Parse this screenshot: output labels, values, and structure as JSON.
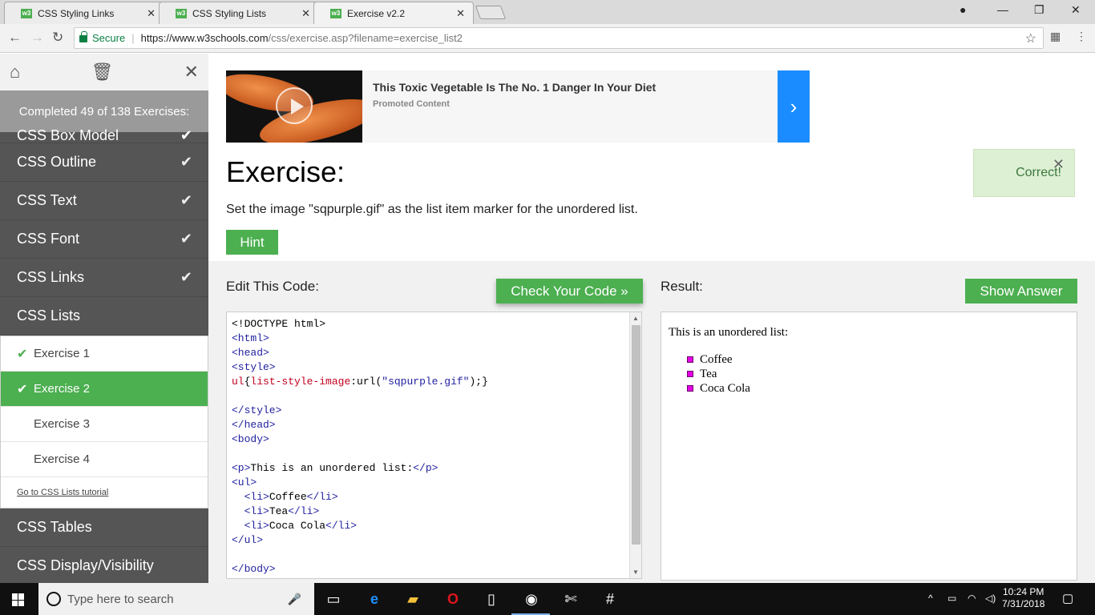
{
  "browser": {
    "tabs": [
      {
        "label": "CSS Styling Links",
        "favicon": "w3"
      },
      {
        "label": "CSS Styling Lists",
        "favicon": "w3"
      },
      {
        "label": "Exercise v2.2",
        "favicon": "w3"
      }
    ],
    "secure_label": "Secure",
    "url_host": "https://www.w3schools.com",
    "url_path": "/css/exercise.asp?filename=exercise_list2"
  },
  "sidebar": {
    "progress": "Completed 49 of 138 Exercises:",
    "cut_item": "CSS Box Model",
    "items": [
      {
        "label": "CSS Outline"
      },
      {
        "label": "CSS Text"
      },
      {
        "label": "CSS Font"
      },
      {
        "label": "CSS Links"
      },
      {
        "label": "CSS Lists"
      }
    ],
    "subitems": [
      {
        "label": "Exercise 1",
        "done": true
      },
      {
        "label": "Exercise 2",
        "done": true,
        "active": true
      },
      {
        "label": "Exercise 3",
        "done": false
      },
      {
        "label": "Exercise 4",
        "done": false
      }
    ],
    "tutorial_link": "Go to CSS Lists tutorial",
    "items_after": [
      {
        "label": "CSS Tables"
      },
      {
        "label": "CSS Display/Visibility"
      }
    ]
  },
  "ad": {
    "title": "This Toxic Vegetable Is The No. 1 Danger In Your Diet",
    "subtitle": "Promoted Content"
  },
  "exercise": {
    "title": "Exercise:",
    "description": "Set the image \"sqpurple.gif\" as the list item marker for the unordered list.",
    "hint_label": "Hint",
    "toast": "Correct!"
  },
  "editor": {
    "label": "Edit This Code:",
    "check_label": "Check Your Code »"
  },
  "result": {
    "label": "Result:",
    "answer_label": "Show Answer",
    "paragraph": "This is an unordered list:",
    "list": [
      "Coffee",
      "Tea",
      "Coca Cola"
    ]
  },
  "taskbar": {
    "search_placeholder": "Type here to search",
    "time": "10:24 PM",
    "date": "7/31/2018"
  },
  "colors": {
    "accent": "#4caf50",
    "sidebar": "#555555",
    "ad_arrow": "#1a8cff"
  }
}
